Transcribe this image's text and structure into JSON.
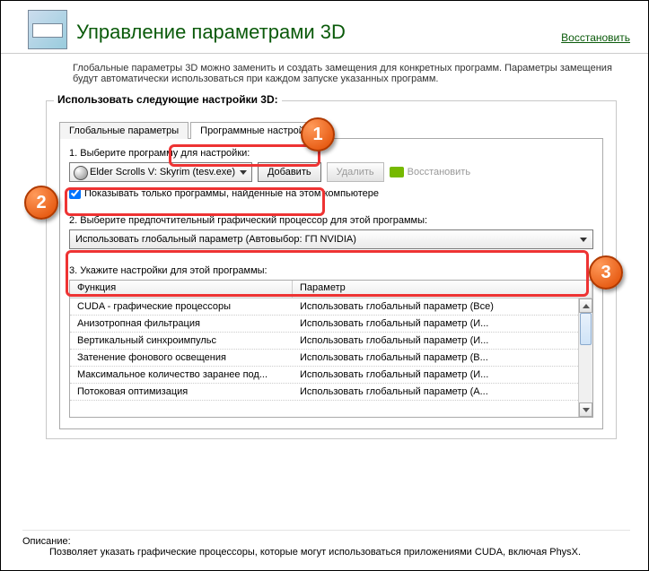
{
  "header": {
    "title": "Управление параметрами 3D",
    "restore_link": "Восстановить"
  },
  "intro": "Глобальные параметры 3D можно заменить и создать замещения для конкретных программ. Параметры замещения будут автоматически использоваться при каждом запуске указанных программ.",
  "group_label": "Использовать следующие настройки 3D:",
  "tabs": {
    "global": "Глобальные параметры",
    "program": "Программные настройки"
  },
  "step1": {
    "label": "1. Выберите программу для настройки:",
    "selected_program": "Elder Scrolls V: Skyrim (tesv.exe)",
    "add_btn": "Добавить",
    "remove_btn": "Удалить",
    "restore_btn": "Восстановить",
    "checkbox": "Показывать только программы, найденные на этом компьютере"
  },
  "step2": {
    "label": "2. Выберите предпочтительный графический процессор для этой программы:",
    "selected": "Использовать глобальный параметр (Автовыбор: ГП NVIDIA)"
  },
  "step3": {
    "label": "3. Укажите настройки для этой программы:",
    "col_fn": "Функция",
    "col_pm": "Параметр",
    "rows": [
      {
        "fn": "CUDA - графические процессоры",
        "pm": "Использовать глобальный параметр (Все)"
      },
      {
        "fn": "Анизотропная фильтрация",
        "pm": "Использовать глобальный параметр (И..."
      },
      {
        "fn": "Вертикальный синхроимпульс",
        "pm": "Использовать глобальный параметр (И..."
      },
      {
        "fn": "Затенение фонового освещения",
        "pm": "Использовать глобальный параметр (В..."
      },
      {
        "fn": "Максимальное количество заранее под...",
        "pm": "Использовать глобальный параметр (И..."
      },
      {
        "fn": "Потоковая оптимизация",
        "pm": "Использовать глобальный параметр (А..."
      }
    ]
  },
  "description": {
    "label": "Описание:",
    "text": "Позволяет указать графические процессоры, которые могут использоваться приложениями CUDA, включая PhysX."
  },
  "annotations": {
    "a1": "1",
    "a2": "2",
    "a3": "3"
  }
}
